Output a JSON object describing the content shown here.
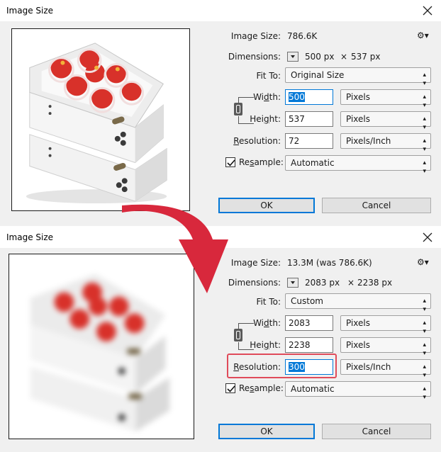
{
  "dialog_top": {
    "title": "Image Size",
    "image_size_label": "Image Size:",
    "image_size_value": "786.6K",
    "dimensions_label": "Dimensions:",
    "dim_width": "500 px",
    "dim_sep": "×",
    "dim_height": "537 px",
    "fit_to_label": "Fit To:",
    "fit_to_value": "Original Size",
    "width_label_pre": "Wi",
    "width_label_u": "d",
    "width_label_post": "th:",
    "width_value": "500",
    "width_unit": "Pixels",
    "height_label_pre": "Hei",
    "height_label_u": "g",
    "height_label_post": "ht:",
    "height_value": "537",
    "height_unit": "Pixels",
    "res_label_u": "R",
    "res_label_post": "esolution:",
    "res_value": "72",
    "res_unit": "Pixels/Inch",
    "resample_label_pre": "Re",
    "resample_label_u": "s",
    "resample_label_post": "ample:",
    "resample_value": "Automatic",
    "ok_label": "OK",
    "cancel_label": "Cancel"
  },
  "dialog_bottom": {
    "title": "Image Size",
    "image_size_label": "Image Size:",
    "image_size_value": "13.3M (was 786.6K)",
    "dimensions_label": "Dimensions:",
    "dim_width": "2083 px",
    "dim_sep": "×",
    "dim_height": "2238 px",
    "fit_to_label": "Fit To:",
    "fit_to_value": "Custom",
    "width_label_pre": "Wi",
    "width_label_u": "d",
    "width_label_post": "th:",
    "width_value": "2083",
    "width_unit": "Pixels",
    "height_label_pre": "Hei",
    "height_label_u": "g",
    "height_label_post": "ht:",
    "height_value": "2238",
    "height_unit": "Pixels",
    "res_label_u": "R",
    "res_label_post": "esolution:",
    "res_value": "300",
    "res_unit": "Pixels/Inch",
    "resample_label_pre": "Re",
    "resample_label_u": "s",
    "resample_label_post": "ample:",
    "resample_value": "Automatic",
    "ok_label": "OK",
    "cancel_label": "Cancel"
  },
  "icons": {
    "close": "close-icon",
    "gear": "gear-icon",
    "link": "chain-link-icon",
    "arrow": "curved-arrow-icon"
  },
  "colors": {
    "accent": "#0078d7",
    "highlight": "#e04b5a",
    "arrow": "#d8283c"
  }
}
